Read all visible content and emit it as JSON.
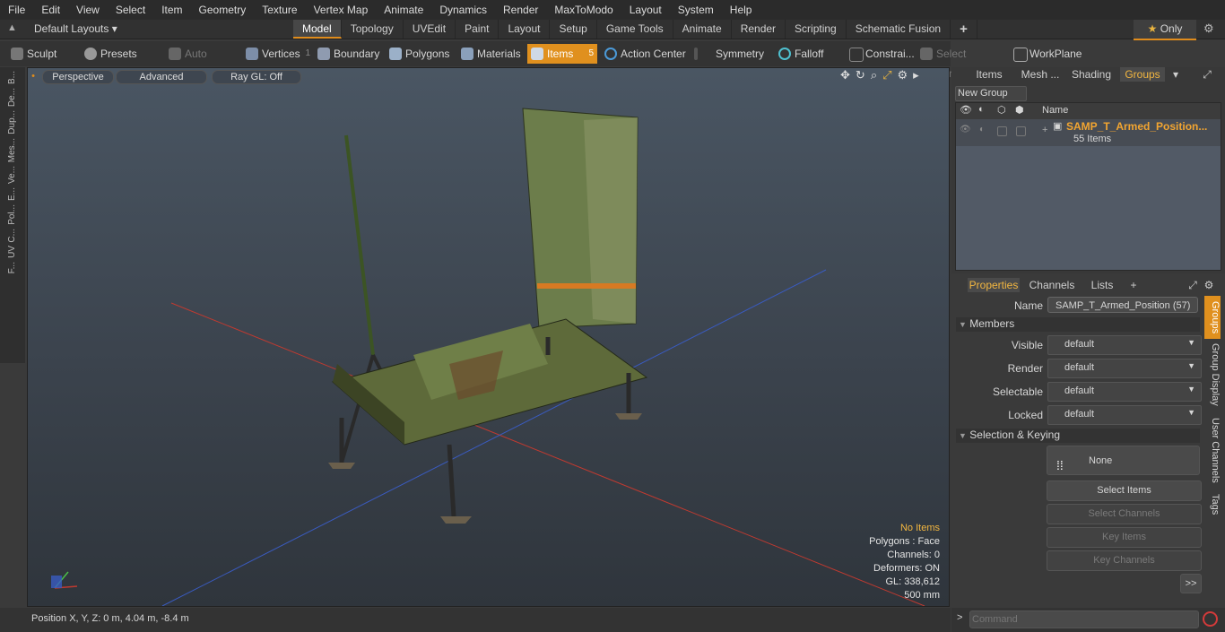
{
  "menu": [
    "File",
    "Edit",
    "View",
    "Select",
    "Item",
    "Geometry",
    "Texture",
    "Vertex Map",
    "Animate",
    "Dynamics",
    "Render",
    "MaxToModo",
    "Layout",
    "System",
    "Help"
  ],
  "layouts_label": "Default Layouts",
  "mode_tabs": [
    "Model",
    "Topology",
    "UVEdit",
    "Paint",
    "Layout",
    "Setup",
    "Game Tools",
    "Animate",
    "Render",
    "Scripting",
    "Schematic Fusion"
  ],
  "only_label": "Only",
  "toolbar": {
    "sculpt": "Sculpt",
    "presets": "Presets",
    "auto_select": "Auto Select",
    "vertices": "Vertices",
    "vertices_count": "1",
    "boundary": "Boundary",
    "polygons": "Polygons",
    "materials": "Materials",
    "items": "Items",
    "items_count": "5",
    "action_center": "Action Center",
    "symmetry": "Symmetry",
    "falloff": "Falloff",
    "constraints": "Constrai...",
    "select_through": "Select Through",
    "workplane": "WorkPlane"
  },
  "viewport": {
    "perspective": "Perspective",
    "advanced": "Advanced",
    "raygl": "Ray GL: Off",
    "stats": {
      "no_items": "No Items",
      "polygons": "Polygons : Face",
      "channels": "Channels: 0",
      "deformers": "Deformers: ON",
      "gl": "GL: 338,612",
      "scale": "500 mm"
    }
  },
  "left_tabs": [
    "B...",
    "De...",
    "Dup...",
    "Mes...",
    "Ve...",
    "E...",
    "Pol...",
    "C...",
    "UV",
    "F..."
  ],
  "top_panel": {
    "tabs": [
      "Items",
      "Mesh ...",
      "Shading",
      "Groups"
    ],
    "new_group": "New Group",
    "col_name": "Name",
    "group_name": "SAMP_T_Armed_Position...",
    "group_count": "55 Items"
  },
  "properties": {
    "tabs": [
      "Properties",
      "Channels",
      "Lists"
    ],
    "name_label": "Name",
    "name_value": "SAMP_T_Armed_Position (57)",
    "members": "Members",
    "visible": "Visible",
    "render": "Render",
    "selectable": "Selectable",
    "locked": "Locked",
    "default": "default",
    "sel_keying": "Selection & Keying",
    "none": "None",
    "select_items": "Select Items",
    "select_channels": "Select Channels",
    "key_items": "Key Items",
    "key_channels": "Key Channels",
    "more": ">>",
    "side_tabs": [
      "Groups",
      "Group Display",
      "User Channels",
      "Tags"
    ]
  },
  "status": {
    "position": "Position X, Y, Z:   0 m, 4.04 m, -8.4 m",
    "command_placeholder": "Command"
  },
  "colors": {
    "accent": "#e0901e",
    "selected_text": "#f2a531"
  }
}
